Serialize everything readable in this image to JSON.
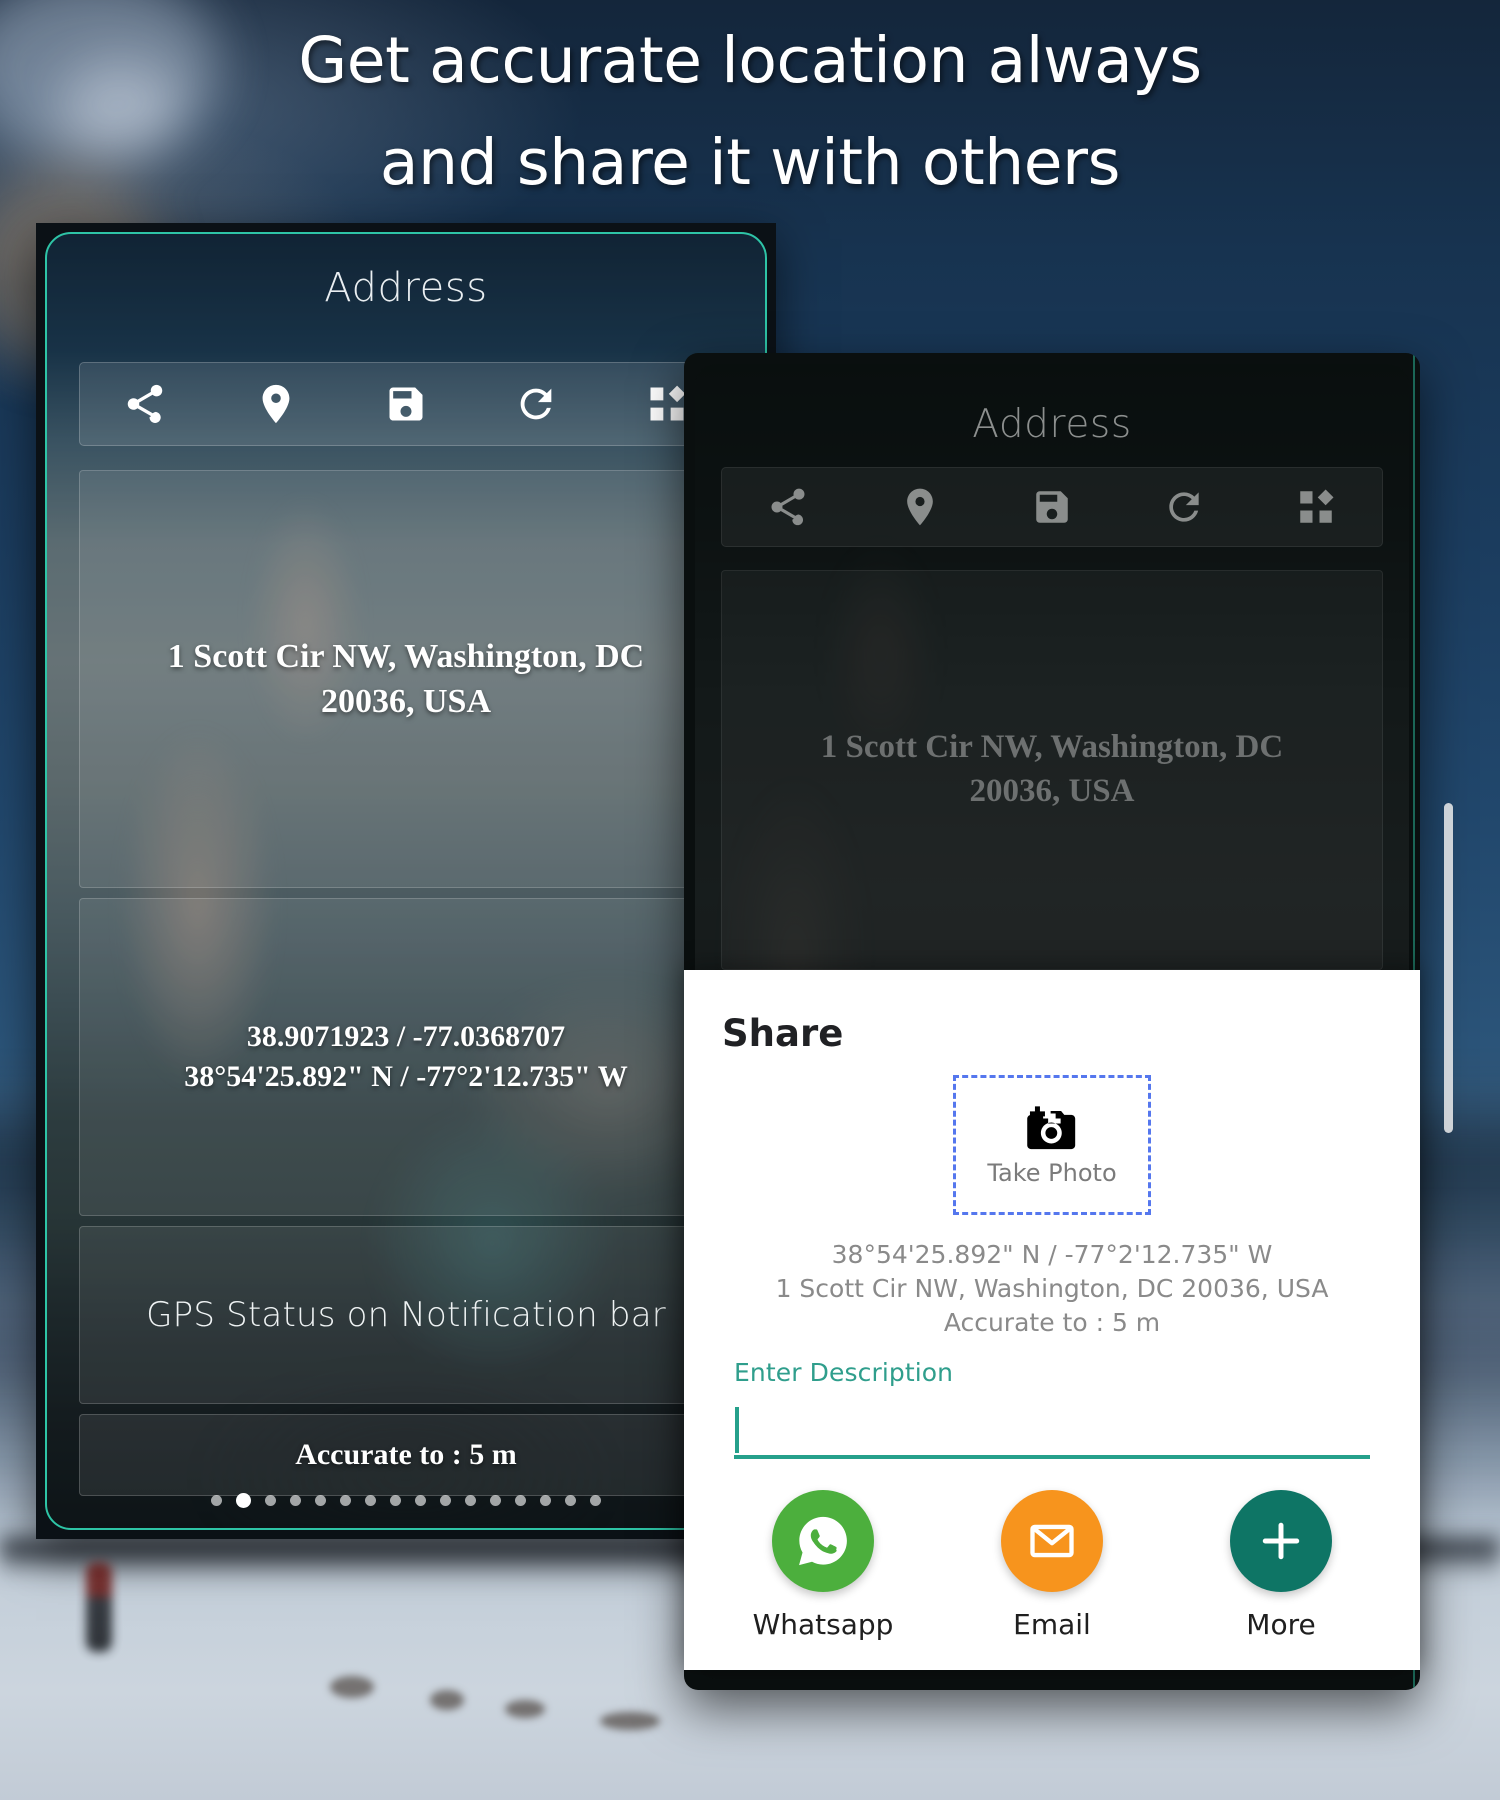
{
  "headline": {
    "line1": "Get accurate location always",
    "line2": "and share it with others"
  },
  "colors": {
    "accent_teal": "#2ec4a6",
    "field_teal": "#25a08b",
    "whatsapp_green": "#4caf3d",
    "email_orange": "#f7941d",
    "more_teal": "#0e7565",
    "dashed_blue": "#5577ee",
    "background_dark_blue": "#14263b"
  },
  "phone_left": {
    "app_title": "Address",
    "toolbar": [
      {
        "name": "share-icon",
        "label": "Share"
      },
      {
        "name": "location-pin-icon",
        "label": "Location"
      },
      {
        "name": "save-icon",
        "label": "Save"
      },
      {
        "name": "refresh-icon",
        "label": "Refresh"
      },
      {
        "name": "dashboard-icon",
        "label": "Widgets"
      }
    ],
    "address_line1": "1 Scott Cir NW, Washington, DC",
    "address_line2": "20036, USA",
    "coords_decimal": "38.9071923 / -77.0368707",
    "coords_dms": "38°54'25.892\" N / -77°2'12.735\" W",
    "gps_status": "GPS Status on Notification bar",
    "accuracy": "Accurate to : 5 m",
    "pager": {
      "total": 16,
      "active_index": 1
    }
  },
  "phone_right": {
    "app_title": "Address",
    "toolbar": [
      {
        "name": "share-icon",
        "label": "Share"
      },
      {
        "name": "location-pin-icon",
        "label": "Location"
      },
      {
        "name": "save-icon",
        "label": "Save"
      },
      {
        "name": "refresh-icon",
        "label": "Refresh"
      },
      {
        "name": "dashboard-icon",
        "label": "Widgets"
      }
    ],
    "address_line1": "1 Scott Cir NW, Washington, DC",
    "address_line2": "20036, USA"
  },
  "share_sheet": {
    "title": "Share",
    "take_photo_label": "Take Photo",
    "info_line1": "38°54'25.892\" N / -77°2'12.735\" W",
    "info_line2": "1 Scott Cir NW, Washington, DC 20036, USA",
    "info_line3": "Accurate to : 5 m",
    "description_label": "Enter Description",
    "description_value": "",
    "description_placeholder": "",
    "actions": [
      {
        "label": "Whatsapp",
        "icon": "whatsapp-icon",
        "color": "#4caf3d"
      },
      {
        "label": "Email",
        "icon": "envelope-icon",
        "color": "#f7941d"
      },
      {
        "label": "More",
        "icon": "plus-icon",
        "color": "#0e7565"
      }
    ]
  }
}
